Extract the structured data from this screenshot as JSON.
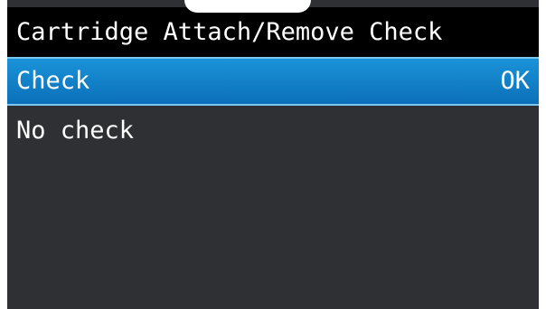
{
  "header": {
    "title": "Cartridge Attach/Remove Check"
  },
  "menu": {
    "items": [
      {
        "label": "Check",
        "value": "OK",
        "selected": true
      },
      {
        "label": "No check",
        "value": "",
        "selected": false
      }
    ]
  },
  "colors": {
    "screen_background": "#2e3033",
    "title_background": "#000000",
    "selection": "#1282cc",
    "text": "#ffffff"
  }
}
